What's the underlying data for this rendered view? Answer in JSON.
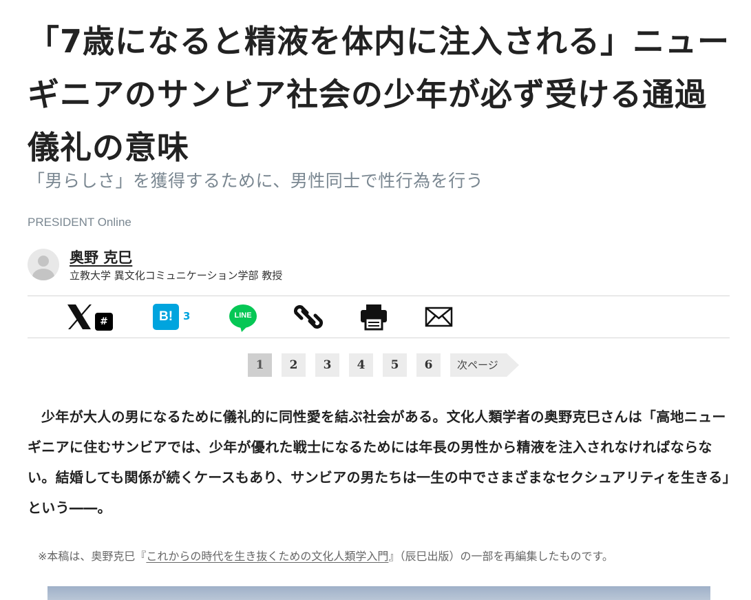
{
  "article": {
    "title": "「7歳になると精液を体内に注入される」ニューギニアのサンビア社会の少年が必ず受ける通過儀礼の意味",
    "subtitle": "「男らしさ」を獲得するために、男性同士で性行為を行う",
    "source": "PRESIDENT Online"
  },
  "author": {
    "name": "奥野 克巳",
    "title": "立教大学 異文化コミュニケーション学部 教授"
  },
  "share": {
    "x_tag": "#",
    "hatena_label": "B!",
    "hatena_count": "3",
    "line_label": "LINE",
    "icons": [
      "x-logo-icon",
      "hatena-bookmark-icon",
      "line-icon",
      "link-icon",
      "print-icon",
      "mail-icon"
    ]
  },
  "pagination": {
    "pages": [
      "1",
      "2",
      "3",
      "4",
      "5",
      "6"
    ],
    "current": "1",
    "next_label": "次ページ"
  },
  "lead": {
    "text": "少年が大人の男になるために儀礼的に同性愛を結ぶ社会がある。文化人類学者の奥野克巳さんは「高地ニューギニアに住むサンビアでは、少年が優れた戦士になるためには年長の男性から精液を注入されなければならない。結婚しても関係が続くケースもあり、サンビアの男たちは一生の中でさまざまなセクシュアリティを生きる」という――。"
  },
  "note": {
    "prefix": "※本稿は、奥野克巳『",
    "link_text": "これからの時代を生き抜くための文化人類学入門",
    "suffix": "』（辰巳出版）の一部を再編集したものです。"
  },
  "colors": {
    "text": "#222222",
    "muted": "#7a8791",
    "hatena": "#00a4de",
    "line": "#06c755",
    "pager_bg": "#ececec"
  }
}
